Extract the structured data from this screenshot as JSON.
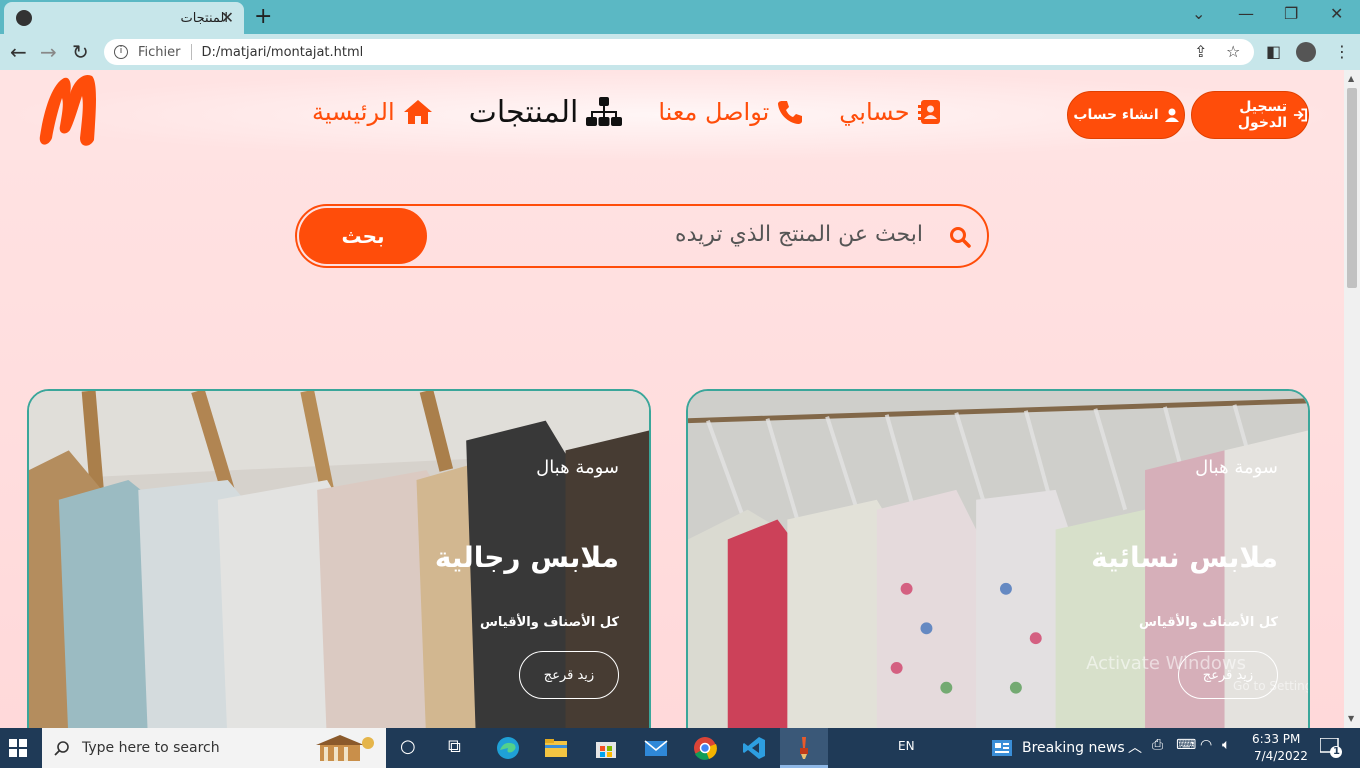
{
  "browser": {
    "tab_title": "المنتجات",
    "url_scheme": "Fichier",
    "url": "D:/matjari/montajat.html"
  },
  "colors": {
    "accent": "#ff4d0a",
    "card_border": "#3aa69a",
    "page_bg": "#ffdede"
  },
  "header": {
    "nav": [
      {
        "label": "الرئيسية",
        "icon": "home-icon"
      },
      {
        "label": "المنتجات",
        "icon": "sitemap-icon",
        "active": true
      },
      {
        "label": "تواصل معنا",
        "icon": "phone-icon"
      },
      {
        "label": "حسابي",
        "icon": "contact-card-icon"
      }
    ],
    "signup_label": "انشاء حساب",
    "login_label": "تسجيل الدخول"
  },
  "search": {
    "placeholder": "ابحث عن المنتج الذي تريده",
    "button_label": "بحث"
  },
  "cards": [
    {
      "subtitle": "سومة هبال",
      "title": "ملابس رجالية",
      "desc": "كل الأصناف والأقياس",
      "button": "زيد قرعج"
    },
    {
      "subtitle": "سومة هبال",
      "title": "ملابس نسائية",
      "desc": "كل الأصناف والأقياس",
      "button": "زيد قرعج"
    }
  ],
  "watermark": {
    "line1": "Activate Windows",
    "line2": "Go to Settings to activate Windows."
  },
  "taskbar": {
    "search_placeholder": "Type here to search",
    "language": "EN",
    "news": "Breaking news",
    "time": "6:33 PM",
    "date": "7/4/2022",
    "notifications": "1"
  }
}
